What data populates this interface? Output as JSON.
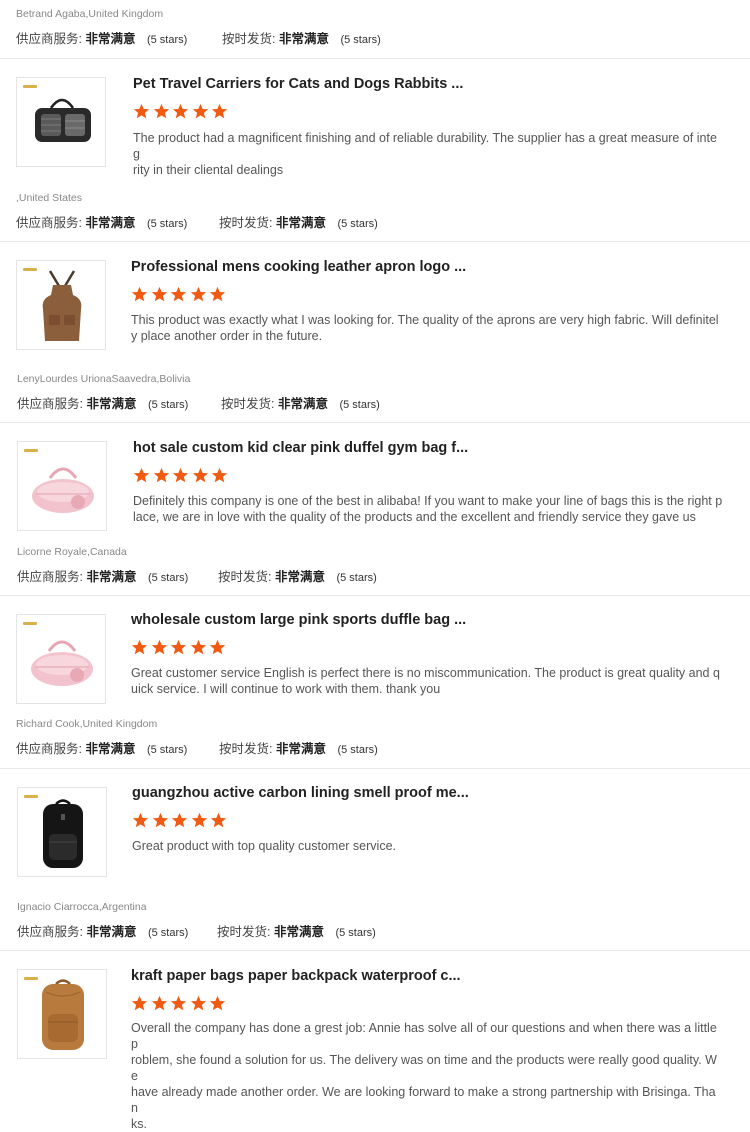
{
  "labels": {
    "supplier_service": "供应商服务:",
    "on_time": "按时发货:",
    "very_satisfied": "非常满意",
    "five_stars": "(5 stars)"
  },
  "colors": {
    "star": "#f05a12",
    "divider": "#e8e8e8"
  },
  "top": {
    "reviewer": "Betrand Agaba,United Kingdom"
  },
  "reviews": [
    {
      "title": "Pet Travel Carriers for Cats and Dogs Rabbits ...",
      "rating": 5,
      "image_icon": "pet-carrier-icon",
      "comment_lines": [
        "The product had a magnificent finishing and of reliable durability. The supplier has a great measure of integ",
        "rity in their cliental dealings"
      ],
      "reviewer": ",United States"
    },
    {
      "title": "Professional mens cooking leather apron logo ...",
      "rating": 5,
      "image_icon": "apron-icon",
      "comment_lines": [
        "This product was exactly what I was looking for. The quality of the aprons are very high fabric. Will definitel",
        "y place another order in the future."
      ],
      "reviewer": "LenyLourdes UrionaSaavedra,Bolivia"
    },
    {
      "title": "hot sale custom kid clear pink duffel gym bag f...",
      "rating": 5,
      "image_icon": "pink-duffel-bag-icon",
      "comment_lines": [
        "Definitely this company is one of the best in alibaba! If you want to make your line of bags this is the right p",
        "lace,  we are in love with the quality of the products and the excellent and friendly service they gave us"
      ],
      "reviewer": "Licorne Royale,Canada"
    },
    {
      "title": "wholesale custom large pink sports duffle bag ...",
      "rating": 5,
      "image_icon": "pink-duffel-bag-icon",
      "comment_lines": [
        "Great customer service English is perfect there is no miscommunication. The product is great quality and q",
        "uick service. I will continue to work with them. thank you"
      ],
      "reviewer": "Richard Cook,United Kingdom"
    },
    {
      "title": "guangzhou active carbon lining smell proof me...",
      "rating": 5,
      "image_icon": "black-backpack-icon",
      "comment_lines": [
        "Great product with top quality customer service."
      ],
      "reviewer": "Ignacio Ciarrocca,Argentina"
    },
    {
      "title": "kraft paper bags paper backpack waterproof c...",
      "rating": 5,
      "image_icon": "kraft-backpack-icon",
      "comment_lines": [
        "Overall the company has done a grest job: Annie has solve all of our questions and when there was a little p",
        "roblem, she found a solution for us. The delivery was on time and the products were really good quality. We",
        "have already made another order. We are looking forward to make a strong partnership with Brisinga. Than",
        "ks."
      ]
    }
  ]
}
